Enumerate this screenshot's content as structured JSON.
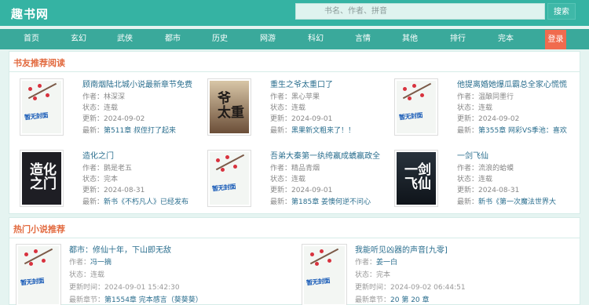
{
  "header": {
    "logo": "趣书网",
    "search_placeholder": "书名、作者、拼音",
    "search_button": "搜索"
  },
  "nav": {
    "items": [
      "首页",
      "玄幻",
      "武侠",
      "都市",
      "历史",
      "网游",
      "科幻",
      "言情",
      "其他",
      "排行",
      "完本"
    ],
    "login": "登录"
  },
  "recommend": {
    "title": "书友推荐阅读",
    "labels": {
      "author": "作者：",
      "status": "状态：",
      "updated": "更新：",
      "latest": "最新："
    },
    "books": [
      {
        "title": "顾南烟陆北城小说最新章节免费",
        "author": "林深深",
        "status": "连载",
        "updated": "2024-09-02",
        "latest": "第511章 叔侄打了起来",
        "cover": "default"
      },
      {
        "title": "重生之爷太重口了",
        "author": "黑心苹果",
        "status": "连载",
        "updated": "2024-09-01",
        "latest": "黑果新文粗来了！！",
        "cover": "warm"
      },
      {
        "title": "他提离婚她爆瓜霸总全家心慌慌",
        "author": "温酿同墨行",
        "status": "连载",
        "updated": "2024-09-02",
        "latest": "第355章 网彩VS季池：喜欢",
        "cover": "default"
      },
      {
        "title": "造化之门",
        "author": "鹅是老五",
        "status": "完本",
        "updated": "2024-08-31",
        "latest": "新书《不朽凡人》已经发布",
        "cover": "dark"
      },
      {
        "title": "吾弟大秦第一纨绔嬴成蟜嬴政全",
        "author": "精品青烟",
        "status": "连载",
        "updated": "2024-09-01",
        "latest": "第185章 姜懊何逆不问心",
        "cover": "default"
      },
      {
        "title": "一剑飞仙",
        "author": "流浪的蛤蟆",
        "status": "连载",
        "updated": "2024-08-31",
        "latest": "新书《第一次魔法世界大",
        "cover": "dark2"
      }
    ]
  },
  "hot": {
    "title": "热门小说推荐",
    "labels": {
      "author": "作者：",
      "status": "状态：",
      "updated": "更新时间：",
      "latest": "最新章节："
    },
    "books": [
      {
        "title": "都市：修仙十年，下山即无敌",
        "author": "冯一摘",
        "status": "连载",
        "updated": "2024-09-01 15:42:30",
        "latest": "第1554章 完本感言（葵葵葵）"
      },
      {
        "title": "我能听见凶器的声音[九零]",
        "author": "姜一白",
        "status": "完本",
        "updated": "2024-09-02 06:44:51",
        "latest": "20 第 20 章"
      }
    ]
  },
  "cover_text": "暂无封面",
  "colors": {
    "brand": "#35b3a3",
    "nav": "#3aa99b",
    "accent": "#e26a3f",
    "login": "#f06b4e",
    "link": "#2a6e8e"
  }
}
